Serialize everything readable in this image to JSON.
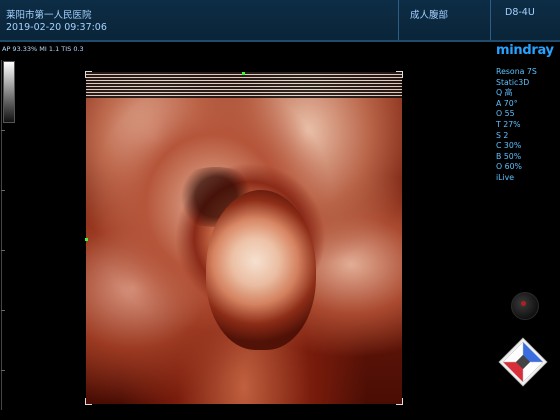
{
  "header": {
    "hospital": "莱阳市第一人民医院",
    "datetime": "2019-02-20    09:37:06",
    "exam_preset": "成人腹部",
    "probe": "D8-4U"
  },
  "acoustic_params": "AP 93.33%  MI 1.1  TIS 0.3",
  "logo": "mindray",
  "sidebar": {
    "items": [
      "Resona 7S",
      "Static3D",
      "Q 高",
      "A 70°",
      "O 55",
      "T 27%",
      "S 2",
      "C 30%",
      "B 50%",
      "O 60%",
      "iLive"
    ]
  },
  "colors": {
    "header_bg": "#0d2d46",
    "header_text": "#a5d2ff",
    "sidebar_text": "#5ec1ff",
    "logo": "#27a3ff",
    "marker": "#33ff33"
  },
  "icons": {
    "orientation_cube": "3d-orientation-cube-icon",
    "trackball": "trackball-icon"
  }
}
